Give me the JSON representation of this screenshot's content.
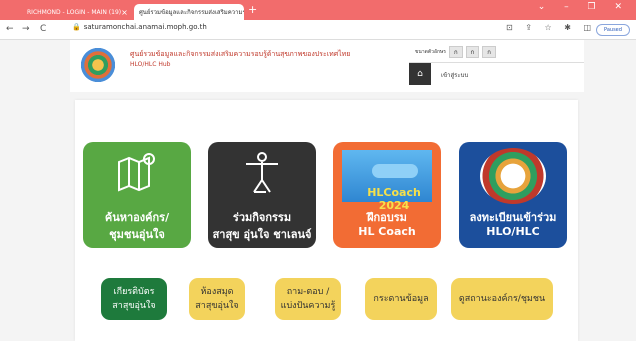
{
  "browser": {
    "tabs": [
      {
        "label": "RICHMOND - LOGIN - MAIN (19)"
      },
      {
        "label": "ศูนย์รวมข้อมูลและกิจกรรมส่งเสริมความรอบรู้ด้านสุขภาพ"
      }
    ],
    "new_tab_symbol": "+",
    "window_controls": "⌄ – ❐ ✕",
    "back": "←",
    "forward": "→",
    "reload": "C",
    "url": "saturamonchai.anamai.moph.go.th",
    "toolbar_icons": "⊡ ⇪ ☆ ✱ ◫",
    "profile_label": "Paused"
  },
  "header": {
    "org_name_th": "ศูนย์รวมข้อมูลและกิจกรรมส่งเสริมความรอบรู้ด้านสุขภาพของประเทศไทย",
    "org_name_en": "HLO/HLC Hub",
    "font_size_label": "ขนาดตัวอักษร",
    "font_size_buttons": [
      "ก",
      "ก",
      "ก"
    ],
    "home_icon": "home-icon",
    "login_label": "เข้าสู่ระบบ"
  },
  "cards": [
    {
      "line1": "ค้นหาองค์กร/",
      "line2": "ชุมชนอุ่นใจ",
      "color": "#58a843",
      "icon": "map-icon"
    },
    {
      "line1": "ร่วมกิจกรรม",
      "line2": "สาสุข อุ่นใจ ชาเลนจ์",
      "color": "#333333",
      "icon": "exercise-icon"
    },
    {
      "line1": "ฝึกอบรม",
      "line2": "HL Coach",
      "color": "#f26c34",
      "icon": "hl-coach-image",
      "image_text": "HLCoach 2024"
    },
    {
      "line1": "ลงทะเบียนเข้าร่วม",
      "line2": "HLO/HLC",
      "color": "#1c4f9c",
      "icon": "hlc-seal-image"
    }
  ],
  "buttons": [
    {
      "line1": "เกียรติบัตร",
      "line2": "สาสุขอุ่นใจ",
      "color": "#1e7a3c"
    },
    {
      "line1": "ห้องสมุด",
      "line2": "สาสุขอุ่นใจ",
      "color": "#f3d35c"
    },
    {
      "line1": "ถาม-ตอบ /",
      "line2": "แบ่งปันความรู้",
      "color": "#f3d35c"
    },
    {
      "line1": "กระดานข้อมูล",
      "line2": "",
      "color": "#f3d35c"
    },
    {
      "line1": "ดูสถานะองค์กร/ชุมชน",
      "line2": "",
      "color": "#f3d35c"
    }
  ]
}
